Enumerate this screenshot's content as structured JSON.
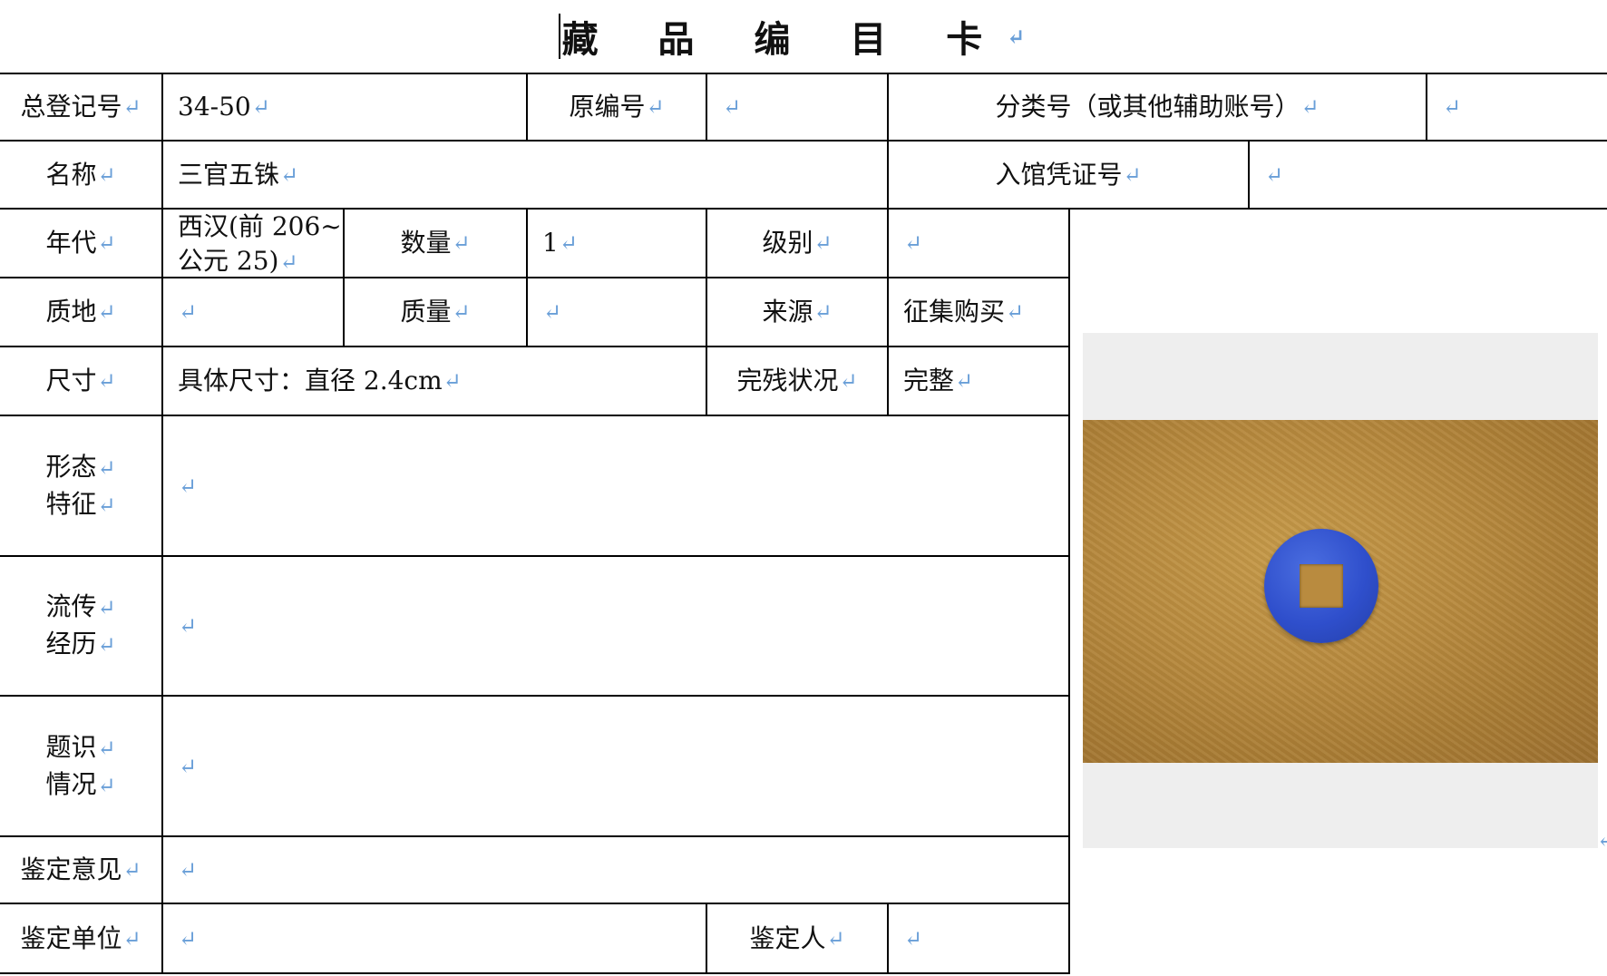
{
  "title": "藏 品 编 目 卡",
  "return_mark": "↵",
  "row1": {
    "reg_label": "总登记号",
    "reg_value": "34-50",
    "orig_label": "原编号",
    "orig_value": "",
    "class_label": "分类号（或其他辅助账号）",
    "class_value": ""
  },
  "row2": {
    "name_label": "名称",
    "name_value": "三官五铢",
    "voucher_label": "入馆凭证号",
    "voucher_value": ""
  },
  "row3": {
    "era_label": "年代",
    "era_value_line1": "西汉(前 206~",
    "era_value_line2": "公元 25)",
    "qty_label": "数量",
    "qty_value": "1",
    "grade_label": "级别",
    "grade_value": ""
  },
  "row4": {
    "material_label": "质地",
    "material_value": "",
    "weight_label": "质量",
    "weight_value": "",
    "source_label": "来源",
    "source_value": "征集购买"
  },
  "row5": {
    "size_label": "尺寸",
    "size_value": "具体尺寸：直径 2.4cm",
    "condition_label": "完残状况",
    "condition_value": "完整"
  },
  "row6": {
    "label_line1": "形态",
    "label_line2": "特征",
    "value": ""
  },
  "row7": {
    "label_line1": "流传",
    "label_line2": "经历",
    "value": ""
  },
  "row8": {
    "label_line1": "题识",
    "label_line2": "情况",
    "value": ""
  },
  "row9": {
    "label": "鉴定意见",
    "value": ""
  },
  "row10": {
    "unit_label": "鉴定单位",
    "unit_value": "",
    "person_label": "鉴定人",
    "person_value": ""
  },
  "colors": {
    "return_mark": "#6a9fd8",
    "coin": "#2f4fcc",
    "cloth": "#b88a3e",
    "photo_frame": "#eeeeee"
  }
}
